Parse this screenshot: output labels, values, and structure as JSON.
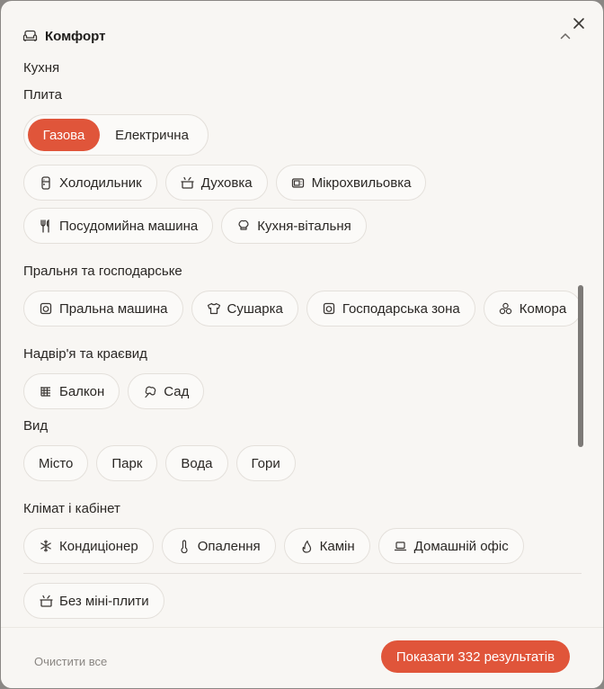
{
  "header": {
    "title": "Комфорт",
    "icon": "sofa-icon"
  },
  "kitchen": {
    "label": "Кухня",
    "stove_label": "Плита",
    "stove_options": [
      "Газова",
      "Електрична"
    ],
    "stove_selected": "Газова",
    "amenities_row1": [
      {
        "label": "Холодильник",
        "icon": "fridge-icon"
      },
      {
        "label": "Духовка",
        "icon": "oven-icon"
      },
      {
        "label": "Мікрохвильовка",
        "icon": "microwave-icon"
      }
    ],
    "amenities_row2": [
      {
        "label": "Посудомийна машина",
        "icon": "utensils-icon"
      },
      {
        "label": "Кухня-вітальня",
        "icon": "chef-hat-icon"
      }
    ]
  },
  "laundry": {
    "label": "Пральня та господарське",
    "items": [
      {
        "label": "Пральна машина",
        "icon": "washing-machine-icon"
      },
      {
        "label": "Сушарка",
        "icon": "shirt-icon"
      },
      {
        "label": "Господарська зона",
        "icon": "washing-machine-icon"
      },
      {
        "label": "Комора",
        "icon": "boxes-icon"
      }
    ]
  },
  "outdoor": {
    "label": "Надвір'я та краєвид",
    "items": [
      {
        "label": "Балкон",
        "icon": "balcony-icon"
      },
      {
        "label": "Сад",
        "icon": "tree-icon"
      }
    ]
  },
  "view": {
    "label": "Вид",
    "items": [
      "Місто",
      "Парк",
      "Вода",
      "Гори"
    ]
  },
  "climate": {
    "label": "Клімат і кабінет",
    "items": [
      {
        "label": "Кондиціонер",
        "icon": "snowflake-icon"
      },
      {
        "label": "Опалення",
        "icon": "thermometer-icon"
      },
      {
        "label": "Камін",
        "icon": "flame-icon"
      },
      {
        "label": "Домашній офіс",
        "icon": "laptop-icon"
      }
    ]
  },
  "extra": {
    "label": "Без міні-плити",
    "icon": "pot-icon"
  },
  "footer": {
    "clear_label": "Очистити все",
    "show_label": "Показати 332 результатів"
  },
  "colors": {
    "accent": "#e0553a",
    "background": "#f8f6f3",
    "chip_border": "#e4e0db"
  }
}
